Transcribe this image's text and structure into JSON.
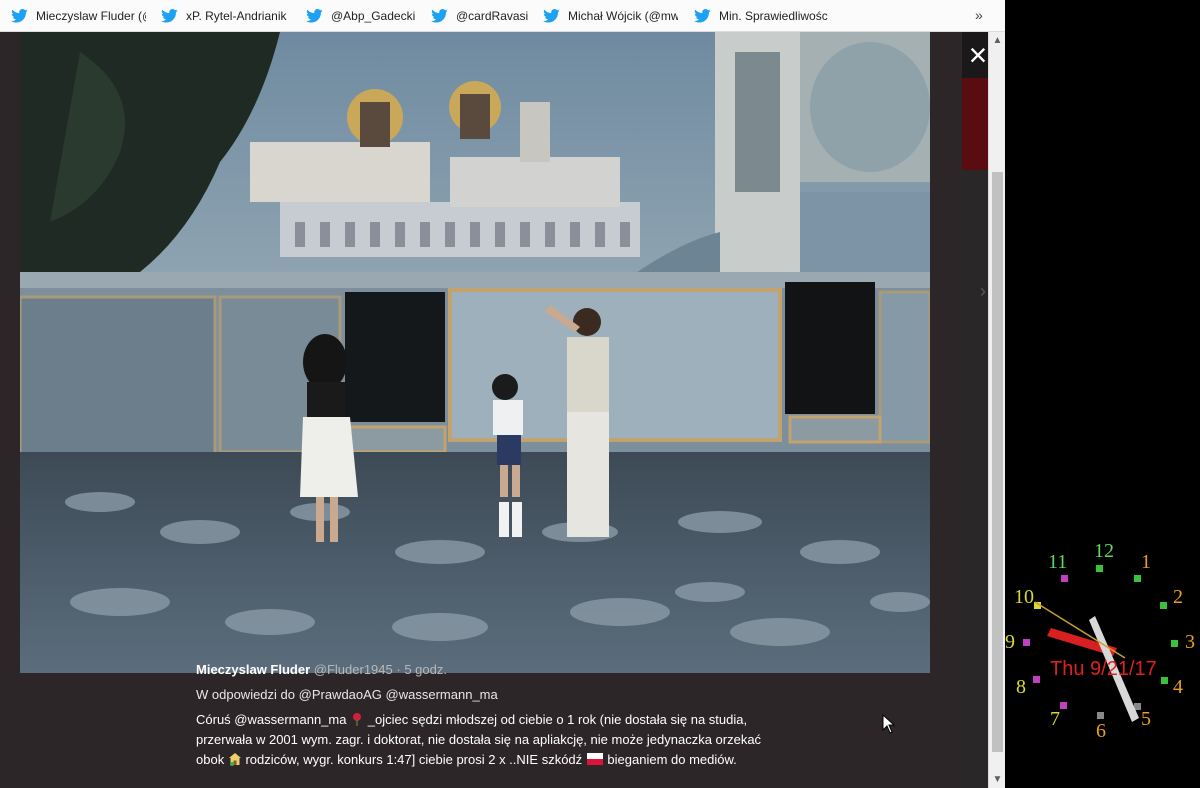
{
  "bookmarks": [
    {
      "label": "Mieczyslaw Fluder (@",
      "icon": "twitter-icon"
    },
    {
      "label": "xP. Rytel-Andrianik",
      "icon": "twitter-icon"
    },
    {
      "label": "@Abp_Gadecki",
      "icon": "twitter-icon"
    },
    {
      "label": "@cardRavasi",
      "icon": "twitter-icon"
    },
    {
      "label": "Michał Wójcik (@mw",
      "icon": "twitter-icon"
    },
    {
      "label": "Min. Sprawiedliwośc",
      "icon": "twitter-icon"
    }
  ],
  "bookmarks_overflow": "»",
  "lightbox": {
    "close_label": "×",
    "next_label": "›"
  },
  "tweet": {
    "name": "Mieczyslaw Fluder",
    "handle": "@Fluder1945",
    "separator": "·",
    "time": "5 godz.",
    "reply_prefix": "W odpowiedzi do",
    "reply_to_1": "@PrawdaoAG",
    "reply_to_2": "@wassermann_ma",
    "body_1": "Córuś @wassermann_ma",
    "body_2": "_ojciec sędzi młodszej od ciebie o 1 rok (nie dostała się na studia, przerwała w 2001 wym. zagr. i doktorat, nie dostała się na apliakcję, nie może jedynaczka orzekać obok",
    "body_3": "rodziców, wygr. konkurs 1:47] ciebie prosi 2 x ..NIE szkódź",
    "body_4": "bieganiem do mediów."
  },
  "clock": {
    "numbers": [
      "12",
      "1",
      "2",
      "3",
      "4",
      "5",
      "6",
      "7",
      "8",
      "9",
      "10",
      "11"
    ],
    "date_text": "Thu 9/21/17",
    "colors": {
      "red": "#e02020",
      "orange": "#e8a020",
      "yellow": "#d8d830",
      "green": "#5fd85f"
    }
  },
  "colors": {
    "lightbox_bg": "#2c2628",
    "twitter_blue": "#1da1f2"
  }
}
